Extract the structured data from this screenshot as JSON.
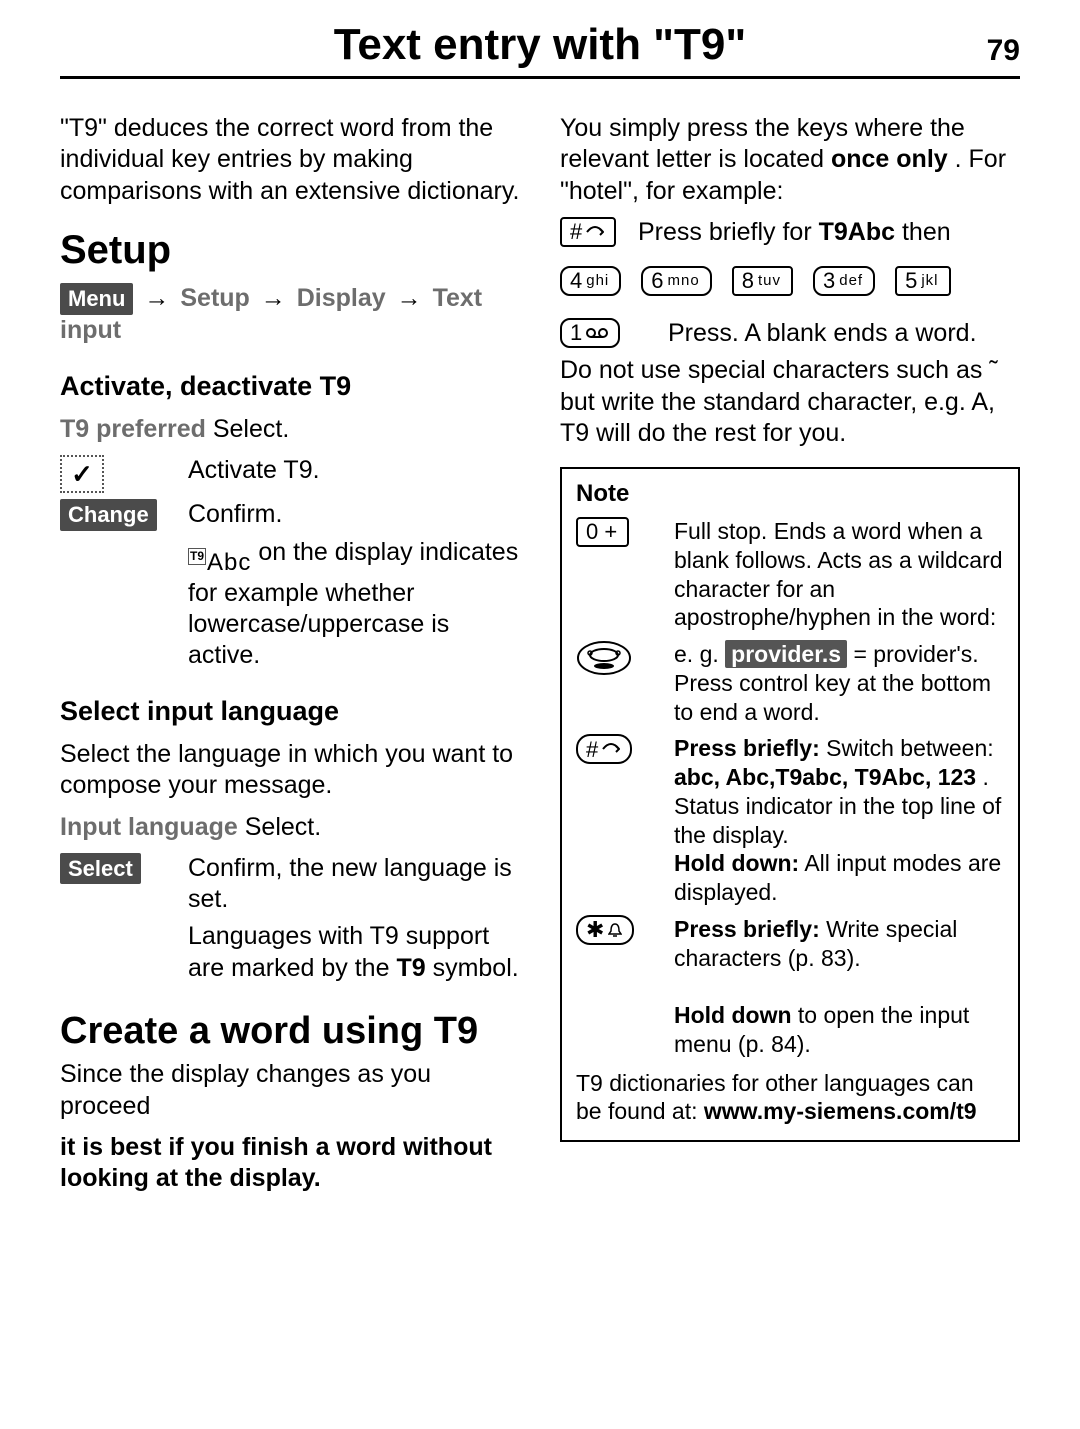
{
  "header": {
    "title": "Text entry with \"T9\"",
    "page_number": "79"
  },
  "left": {
    "intro": "\"T9\" deduces the correct word from the individual key entries by making comparisons with an extensive dictionary.",
    "setup_heading": "Setup",
    "breadcrumb": {
      "menu": "Menu",
      "setup": "Setup",
      "display": "Display",
      "text_input": "Text input"
    },
    "activate_heading": "Activate, deactivate T9",
    "t9_preferred": "T9 preferred",
    "select_word": "Select.",
    "activate_t9": "Activate T9.",
    "change_label": "Change",
    "confirm": "Confirm.",
    "t9abc_label": "Abc",
    "t9abc_note": " on the display indicates for example whether lowercase/uppercase is active.",
    "lang_heading": "Select input language",
    "lang_para": "Select the language in which you want to compose your message.",
    "input_language": "Input language",
    "select_word2": "Select.",
    "select_label": "Select",
    "confirm_lang": "Confirm, the new language is set.",
    "lang_note": "Languages with T9 support are marked by the ",
    "lang_note_bold": "T9",
    "lang_note_tail": " symbol.",
    "create_heading": "Create a word using T9",
    "create_p1": "Since the display changes as you proceed",
    "create_p2": "it is best if you finish a word without looking at the display."
  },
  "right": {
    "intro1": "You simply press the keys where the relevant letter is located ",
    "intro1_bold": "once only",
    "intro1_tail": ". For \"hotel\", for example:",
    "hash_key_label": "#",
    "press_briefly_for": "Press briefly for",
    "t9abc_bold": "T9Abc",
    "then": " then",
    "keys": [
      {
        "num": "4",
        "letters": "ghi"
      },
      {
        "num": "6",
        "letters": "mno"
      },
      {
        "num": "8",
        "letters": "tuv"
      },
      {
        "num": "3",
        "letters": "def"
      },
      {
        "num": "5",
        "letters": "jkl"
      }
    ],
    "key1_label_num": "1",
    "blank_ends": "Press. A blank ends a word.",
    "no_special": "Do not use special characters such as ˜ but write the standard character, e.g. A, T9 will do the rest for you.",
    "note_heading": "Note",
    "zero_key_label": "0 +",
    "zero_text": "Full stop. Ends a word when a blank follows. Acts as a wildcard character for an apostrophe/hyphen in the word:",
    "eg_prefix": "e. g. ",
    "provider_boxed": "provider.s",
    "eg_suffix": " = provider's.",
    "control_key_text": "Press control key at the bottom to end a word.",
    "hash_briefly_bold": "Press briefly:",
    "hash_briefly_1": " Switch between: ",
    "hash_modes": "abc, Abc,T9abc, T9Abc, 123",
    "hash_briefly_2": ". Status indicator in the top line of the display.",
    "hash_hold_bold": "Hold down:",
    "hash_hold_text": " All input modes are displayed.",
    "star_briefly_bold": "Press briefly:",
    "star_briefly_text": " Write special characters (p. 83).",
    "star_hold_bold": "Hold down",
    "star_hold_text": " to open the input menu (p. 84).",
    "note_footer_1": "T9 dictionaries for other languages can be found at: ",
    "note_footer_url": "www.my-siemens.com/t9"
  }
}
